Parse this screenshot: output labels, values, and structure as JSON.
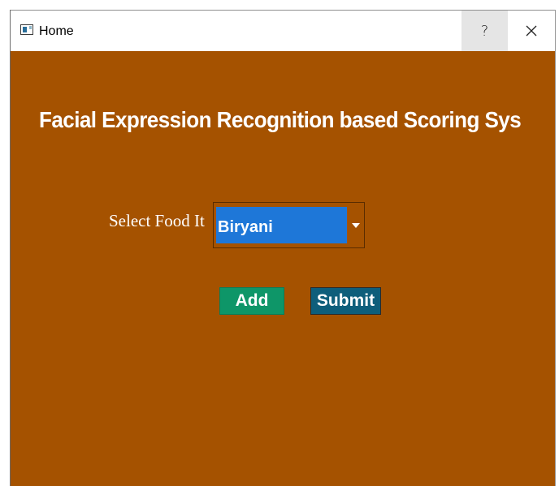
{
  "window": {
    "title": "Home",
    "help_label": "?",
    "close_icon": "close-icon"
  },
  "theme": {
    "background": "#a55200",
    "combo_highlight": "#1e77d8",
    "add_button": "#0e9668",
    "submit_button": "#0e5e7b"
  },
  "main": {
    "heading": "Facial Expression Recognition based Scoring Sys",
    "food_label": "Select Food It",
    "food_select": {
      "selected": "Biryani"
    },
    "add_label": "Add",
    "submit_label": "Submit"
  }
}
